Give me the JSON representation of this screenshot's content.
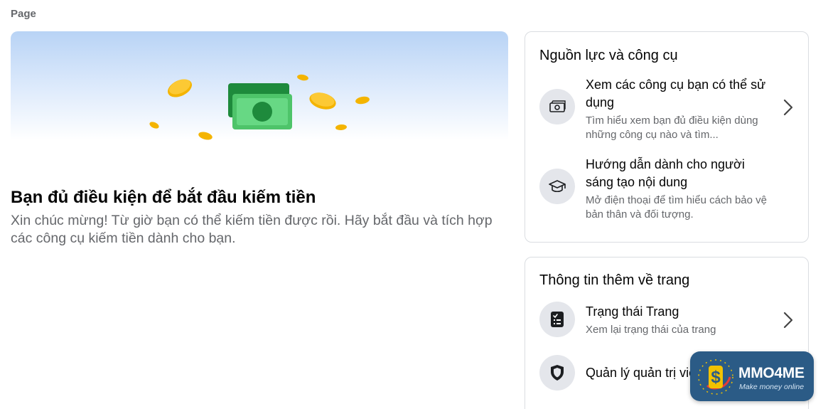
{
  "page_label": "Page",
  "hero": {
    "title": "Bạn đủ điều kiện để bắt đầu kiếm tiền",
    "body": "Xin chúc mừng! Từ giờ bạn có thể kiếm tiền được rồi. Hãy bắt đầu và tích hợp các công cụ kiếm tiền dành cho bạn.",
    "art_icon": "money-coins-illustration"
  },
  "resources_card": {
    "title": "Nguồn lực và công cụ",
    "items": [
      {
        "title": "Xem các công cụ bạn có thể sử dụng",
        "subtitle": "Tìm hiểu xem bạn đủ điều kiện dùng những công cụ nào và tìm...",
        "icon": "money-bill-icon"
      },
      {
        "title": "Hướng dẫn dành cho người sáng tạo nội dung",
        "subtitle": "Mở điện thoại để tìm hiểu cách bảo vệ bản thân và đối tượng.",
        "icon": "graduation-cap-icon"
      }
    ]
  },
  "page_info_card": {
    "title": "Thông tin thêm về trang",
    "items": [
      {
        "title": "Trạng thái Trang",
        "subtitle": "Xem lại trạng thái của trang",
        "icon": "clipboard-checklist-icon"
      },
      {
        "title": "Quản lý quản trị viên",
        "icon": "shield-icon"
      }
    ]
  },
  "watermark": {
    "name": "MMO4ME",
    "tagline": "Make money online"
  },
  "colors": {
    "primary_text": "#050505",
    "secondary_text": "#65676b",
    "border": "#dadde1",
    "icon_bg": "#e4e6eb"
  }
}
